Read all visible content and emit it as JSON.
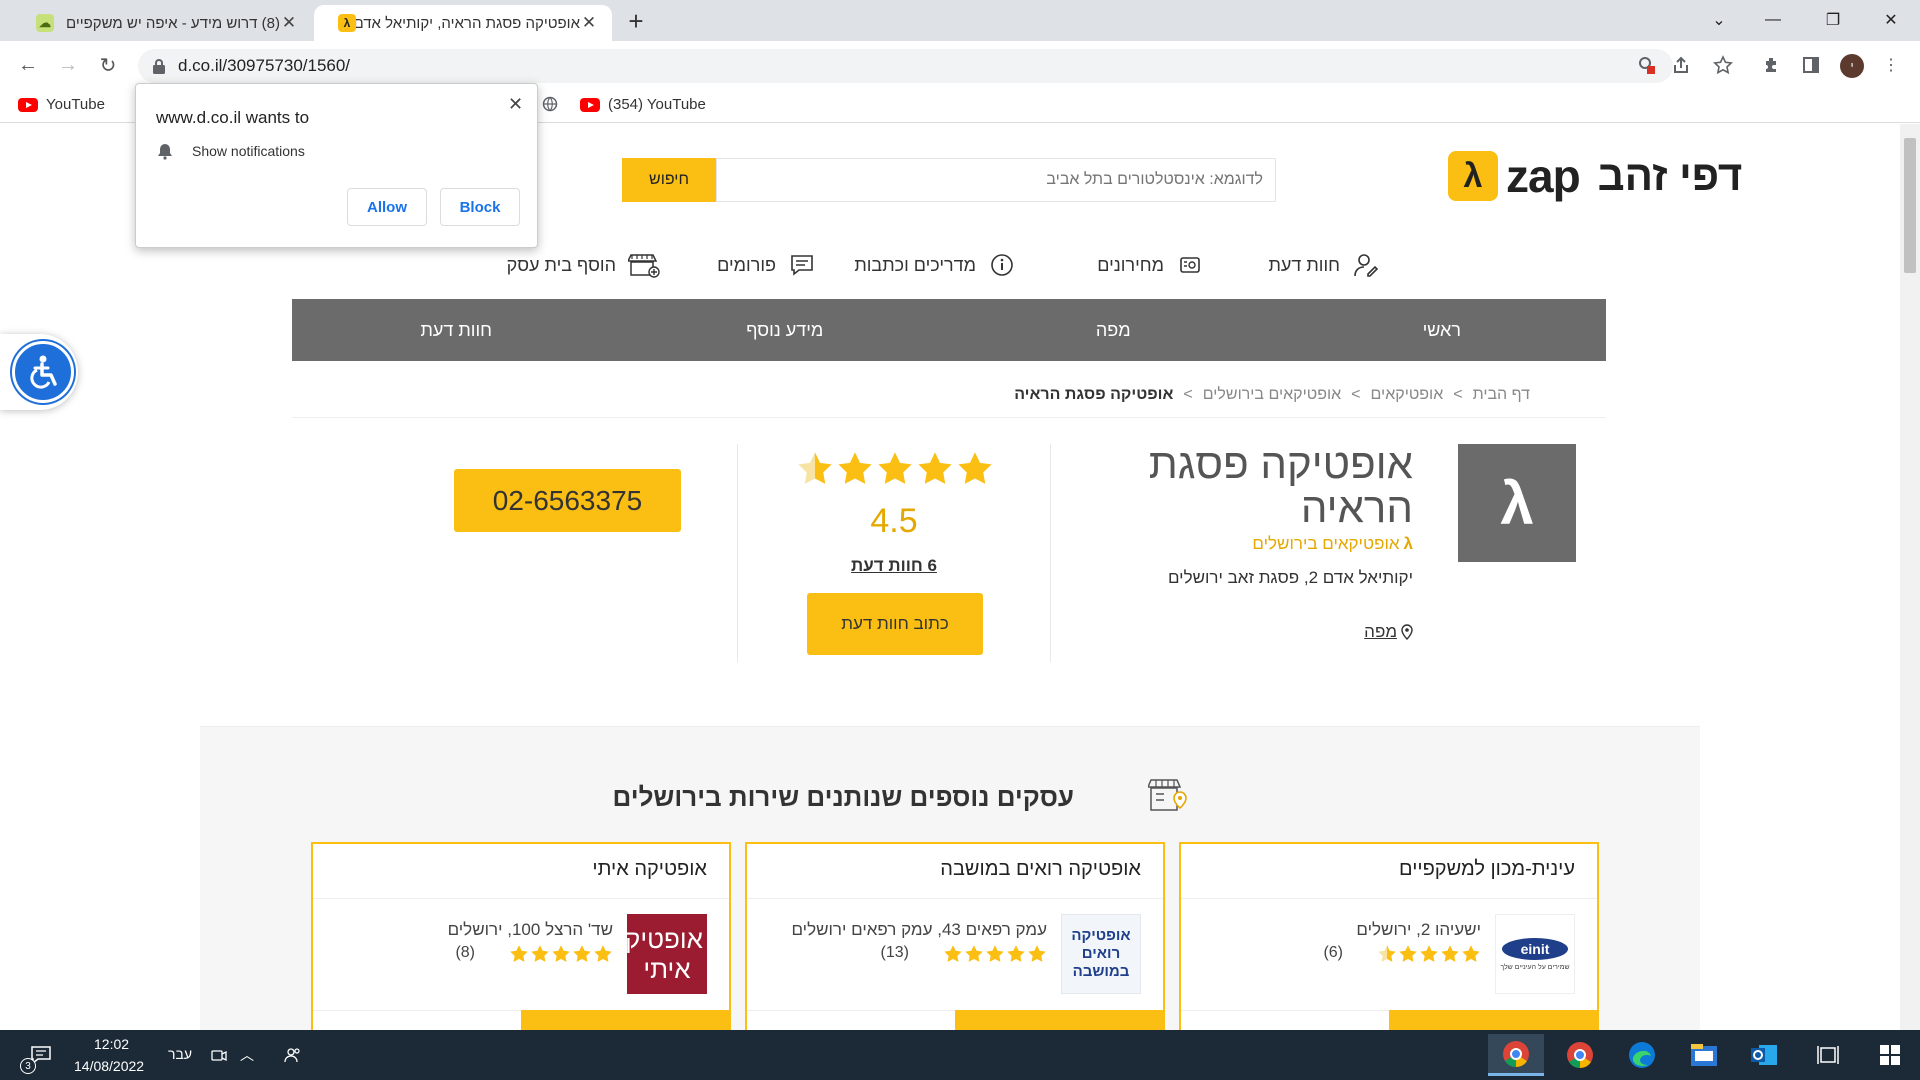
{
  "browser": {
    "tabs": [
      {
        "title": "(8) דרוש מידע - איפה יש משקפיים",
        "active": false
      },
      {
        "title": "אופטיקה פסגת הראיה, יקותיאל אדם",
        "active": true
      }
    ],
    "url": "d.co.il/30975730/1560/",
    "bookmarks": [
      {
        "label": "YouTube",
        "icon": "youtube-icon"
      },
      {
        "label": "(354) YouTube",
        "icon": "youtube-icon"
      }
    ]
  },
  "notification": {
    "title": "www.d.co.il wants to",
    "message": "Show notifications",
    "allow": "Allow",
    "block": "Block"
  },
  "header": {
    "logo_zap": "zap",
    "logo_name": "דפי זהב",
    "search_placeholder": "לדוגמא: אינסטלטורים בתל אביב",
    "search_button": "חיפוש"
  },
  "main_nav": [
    {
      "label": "חוות דעת",
      "icon": "reviewer-icon"
    },
    {
      "label": "מחירונים",
      "icon": "price-list-icon"
    },
    {
      "label": "מדריכים וכתבות",
      "icon": "info-icon"
    },
    {
      "label": "פורומים",
      "icon": "forum-icon"
    },
    {
      "label": "הוסף בית עסק",
      "icon": "add-store-icon"
    }
  ],
  "page_tabs": [
    "ראשי",
    "מפה",
    "מידע נוסף",
    "חוות דעת"
  ],
  "breadcrumb": {
    "items": [
      "דף הבית",
      "אופטיקאים",
      "אופטיקאים בירושלים"
    ],
    "separator": ">",
    "current": "אופטיקה פסגת הראיה"
  },
  "business": {
    "name": "אופטיקה פסגת הראיה",
    "category": "אופטיקאים בירושלים",
    "address": "יקותיאל אדם 2, פסגת זאב ירושלים",
    "map_label": "מפה",
    "rating": "4.5",
    "rating_value": 4.5,
    "reviews_label": "6  חוות דעת",
    "write_review": "כתוב חוות דעת",
    "phone": "02-6563375"
  },
  "more_businesses": {
    "title": "עסקים נוספים שנותנים שירות בירושלים",
    "cards": [
      {
        "name": "עינית-מכון למשקפיים",
        "address": "ישעיהו 2, ירושלים",
        "count": "(6)",
        "rating": 4.5,
        "logo_text": "einit",
        "logo_sub": "שמירים על העיניים שלך"
      },
      {
        "name": "אופטיקה רואים במושבה",
        "address": "עמק רפאים 43, עמק רפאים ירושלים",
        "count": "(13)",
        "rating": 5,
        "logo_text": "אופטיקה רואים במושבה"
      },
      {
        "name": "אופטיקה איתי",
        "address": "שד' הרצל 100, ירושלים",
        "count": "(8)",
        "rating": 5,
        "logo_text": "אופטיקה איתי"
      }
    ]
  },
  "taskbar": {
    "time": "12:02",
    "date": "14/08/2022",
    "language": "עבר",
    "notification_count": "3"
  },
  "colors": {
    "brand_yellow": "#fbbf14",
    "nav_gray": "#6b6b6b",
    "accent_blue": "#1a73e8"
  }
}
